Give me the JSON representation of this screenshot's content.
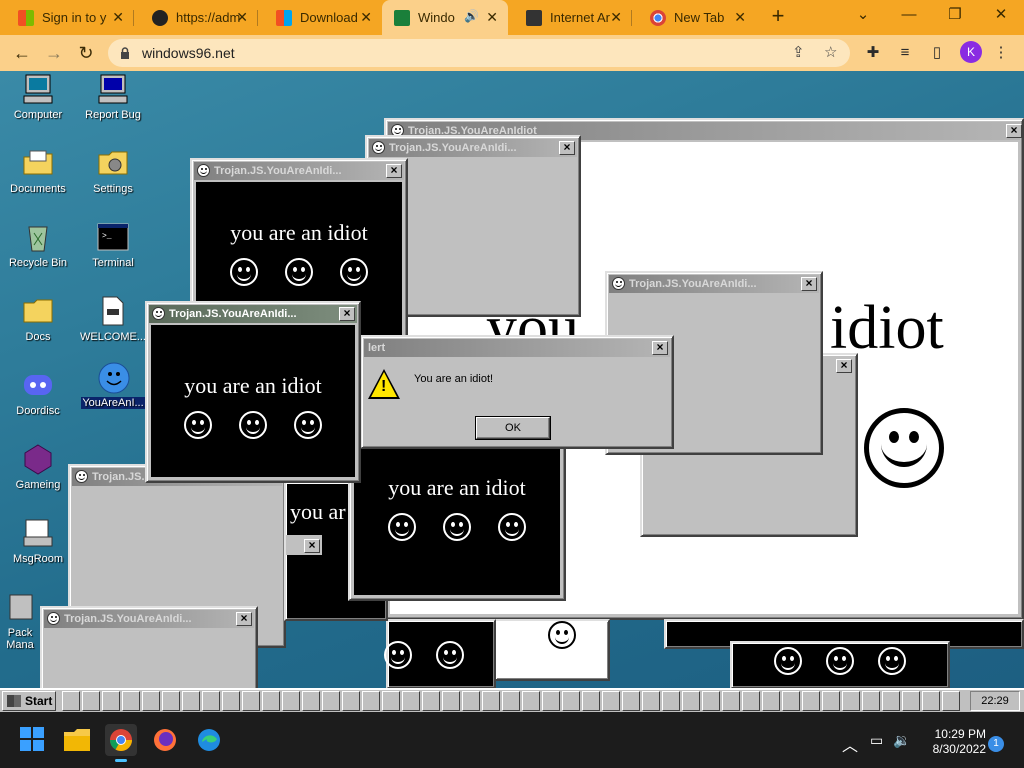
{
  "browser": {
    "tabs": [
      {
        "title": "Sign in to y",
        "favicon": "microsoft-icon"
      },
      {
        "title": "https://adm",
        "favicon": "github-icon"
      },
      {
        "title": "Download",
        "favicon": "microsoft-icon"
      },
      {
        "title": "Windo",
        "favicon": "windows96-icon",
        "active": true,
        "audio": true
      },
      {
        "title": "Internet Ar",
        "favicon": "archive-icon"
      },
      {
        "title": "New Tab",
        "favicon": "chrome-icon"
      }
    ],
    "new_tab": "+",
    "url": "windows96.net",
    "profile_initial": "K",
    "accent": "#f5a623"
  },
  "desktop": {
    "icons": [
      {
        "label": "Computer",
        "name": "computer-icon"
      },
      {
        "label": "Report Bug",
        "name": "report-bug-icon"
      },
      {
        "label": "Documents",
        "name": "documents-icon"
      },
      {
        "label": "Settings",
        "name": "settings-icon"
      },
      {
        "label": "Recycle Bin",
        "name": "recycle-bin-icon"
      },
      {
        "label": "Terminal",
        "name": "terminal-icon"
      },
      {
        "label": "Docs",
        "name": "docs-folder-icon"
      },
      {
        "label": "WELCOME...",
        "name": "welcome-file-icon"
      },
      {
        "label": "Doordisc",
        "name": "doordisc-icon"
      },
      {
        "label": "YouAreAnI...",
        "name": "youareanidiot-icon",
        "selected": true
      },
      {
        "label": "Gameing",
        "name": "gameing-icon"
      },
      {
        "label": "MsgRoom",
        "name": "msgroom-icon"
      },
      {
        "label": "Pack Mana",
        "name": "package-manager-icon"
      }
    ]
  },
  "windows": {
    "title": "Trojan.JS.YouAreAnIdiot",
    "title_short": "Trojan.JS.YouAreAnIdi...",
    "message": "you are an idiot",
    "message_big_left": "you",
    "message_big_right": "idiot",
    "message_partial": "you ar",
    "close": "×"
  },
  "alert": {
    "title": "Alert",
    "title_visible": "lert",
    "text": "You are an idiot!",
    "ok": "OK"
  },
  "w96_taskbar": {
    "start": "Start",
    "clock": "22:29"
  },
  "os_taskbar": {
    "time": "10:29 PM",
    "date": "8/30/2022",
    "notifications": "1"
  }
}
